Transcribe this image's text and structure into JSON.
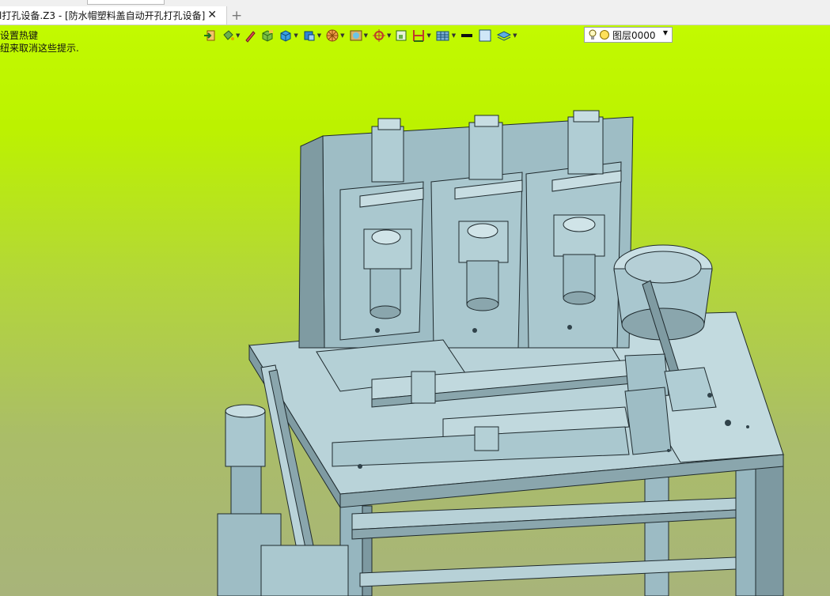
{
  "tab": {
    "title": "l打孔设备.Z3 - [防水帽塑料盖自动开孔打孔设备]",
    "close": "✕",
    "new_tab": "+"
  },
  "hints": {
    "line1": "设置热键",
    "line2": "纽来取消这些提示."
  },
  "toolbar": {
    "layer_value": "图层0000",
    "icons": [
      "exit-icon",
      "paint-bucket-icon",
      "pencil-icon",
      "box-color-icon",
      "solid-icon",
      "face-color-icon",
      "wheel-icon",
      "texture-icon",
      "snap-icon",
      "frame-icon",
      "dimension-icon",
      "grid-icon",
      "line-color-icon",
      "fill-color-icon",
      "layers-icon"
    ]
  },
  "colors": {
    "viewport_top": "#c2fa00",
    "viewport_bottom": "#a8b47a",
    "model_face": "#a9c7cf",
    "model_light": "#c7dde2",
    "model_dark": "#6f8b93",
    "outline": "#1f2a2e"
  }
}
